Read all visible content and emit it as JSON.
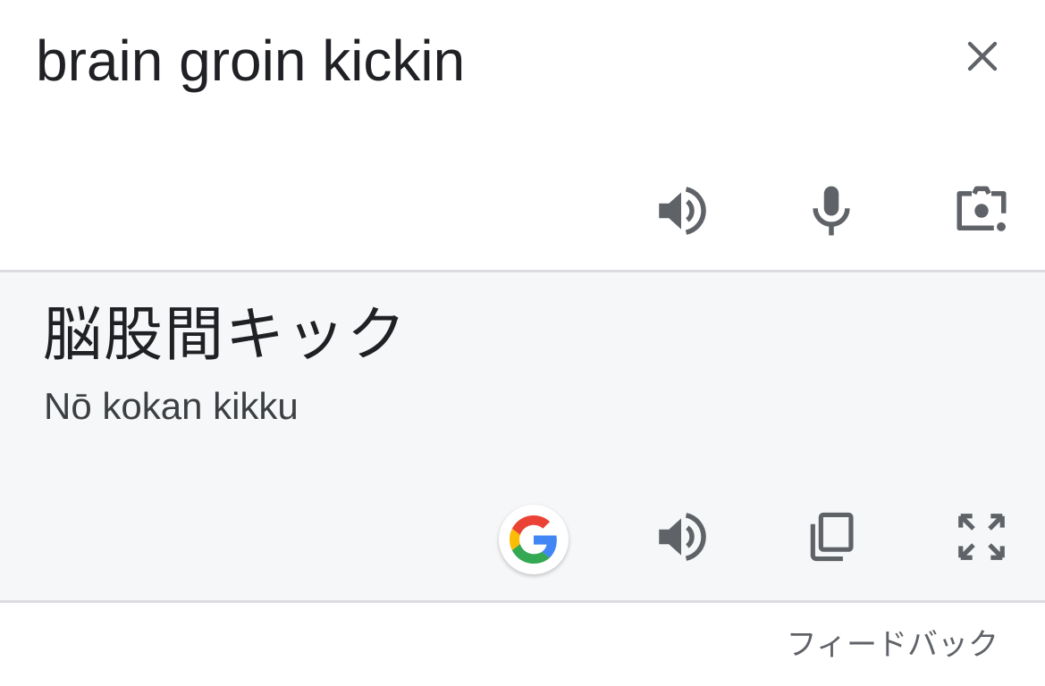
{
  "source": {
    "text": "brain groin kickin",
    "clear_icon": "close-icon",
    "actions": [
      "speaker-icon",
      "microphone-icon",
      "camera-lens-icon"
    ]
  },
  "result": {
    "text": "脳股間キック",
    "romanization": "Nō kokan kikku",
    "actions": [
      "google-g-logo",
      "speaker-icon",
      "copy-icon",
      "fullscreen-icon"
    ]
  },
  "footer": {
    "feedback_label": "フィードバック"
  },
  "colors": {
    "text_primary": "#202124",
    "icon": "#5f6368",
    "result_background": "#f6f7f9",
    "divider": "#dadce0",
    "google_blue": "#4285F4",
    "google_red": "#EA4335",
    "google_yellow": "#FBBC05",
    "google_green": "#34A853"
  }
}
